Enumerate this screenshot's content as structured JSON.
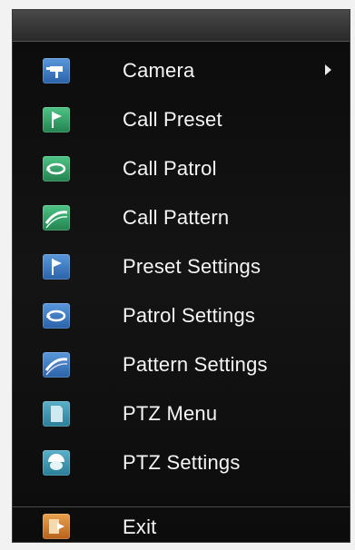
{
  "menu": {
    "items": [
      {
        "label": "Camera",
        "icon": "camera-icon",
        "color": "#2f6fb5"
      },
      {
        "label": "Call Preset",
        "icon": "flag-icon",
        "color": "#2f9e63"
      },
      {
        "label": "Call Patrol",
        "icon": "loop-arrow-icon",
        "color": "#2f9e63"
      },
      {
        "label": "Call Pattern",
        "icon": "pattern-icon",
        "color": "#2f9e63"
      },
      {
        "label": "Preset Settings",
        "icon": "flag-icon",
        "color": "#2f6fb5"
      },
      {
        "label": "Patrol Settings",
        "icon": "loop-arrow-icon",
        "color": "#2f6fb5"
      },
      {
        "label": "Pattern Settings",
        "icon": "pattern-icon",
        "color": "#2f6fb5"
      },
      {
        "label": "PTZ Menu",
        "icon": "document-icon",
        "color": "#2f7e9c"
      },
      {
        "label": "PTZ Settings",
        "icon": "dome-camera-icon",
        "color": "#2f7e9c"
      }
    ],
    "exit": {
      "label": "Exit",
      "icon": "exit-icon",
      "color": "#c8782a"
    }
  }
}
